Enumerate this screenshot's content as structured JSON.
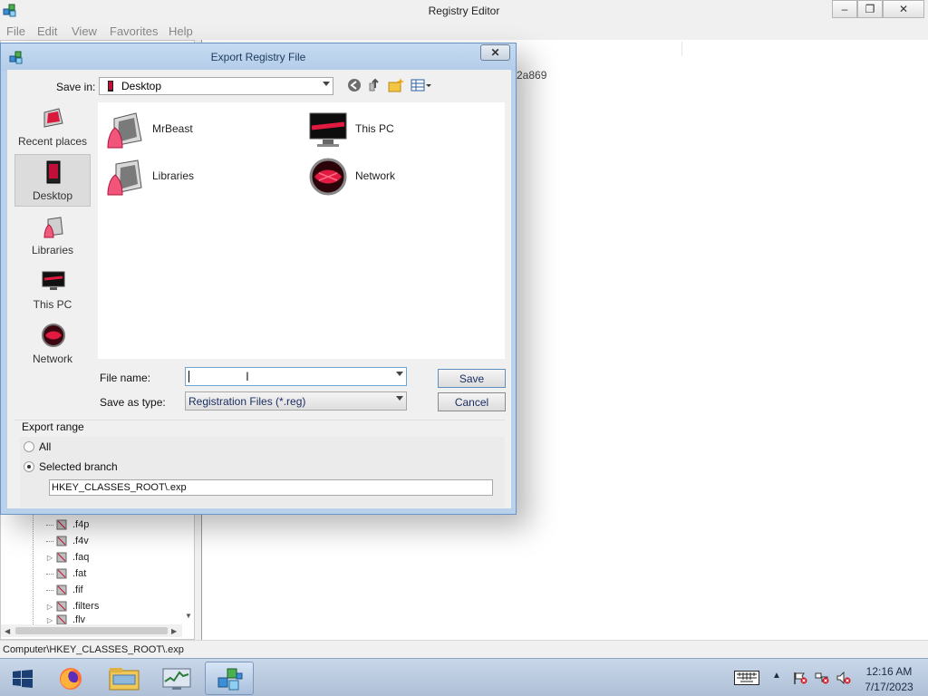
{
  "main_window": {
    "title": "Registry Editor",
    "menu": [
      "File",
      "Edit",
      "View",
      "Favorites",
      "Help"
    ],
    "value_pane_fragment": "2a869",
    "tree_items": [
      {
        "label": ".f4p",
        "expandable": false
      },
      {
        "label": ".f4v",
        "expandable": false
      },
      {
        "label": ".faq",
        "expandable": true
      },
      {
        "label": ".fat",
        "expandable": false
      },
      {
        "label": ".fif",
        "expandable": false
      },
      {
        "label": ".filters",
        "expandable": true
      },
      {
        "label": ".flv",
        "expandable": true
      }
    ],
    "status_path": "Computer\\HKEY_CLASSES_ROOT\\.exp"
  },
  "dialog": {
    "title": "Export Registry File",
    "close_glyph": "✕",
    "save_in_label": "Save in:",
    "save_in_value": "Desktop",
    "places": [
      {
        "label": "Recent places",
        "icon": "recent-places-icon",
        "active": false
      },
      {
        "label": "Desktop",
        "icon": "desktop-icon",
        "active": true
      },
      {
        "label": "Libraries",
        "icon": "libraries-icon",
        "active": false
      },
      {
        "label": "This PC",
        "icon": "this-pc-icon",
        "active": false
      },
      {
        "label": "Network",
        "icon": "network-icon",
        "active": false
      }
    ],
    "files": [
      {
        "name": "MrBeast",
        "icon": "user-folder-icon"
      },
      {
        "name": "This PC",
        "icon": "computer-icon"
      },
      {
        "name": "Libraries",
        "icon": "libraries-icon"
      },
      {
        "name": "Network",
        "icon": "network-icon"
      }
    ],
    "file_name_label": "File name:",
    "file_name_value": "",
    "save_as_type_label": "Save as type:",
    "save_as_type_value": "Registration Files (*.reg)",
    "save_button": "Save",
    "cancel_button": "Cancel",
    "export_range_label": "Export range",
    "range_all_label": "All",
    "range_selected_label": "Selected branch",
    "selected_range": "Selected branch",
    "branch_value": "HKEY_CLASSES_ROOT\\.exp"
  },
  "taskbar": {
    "apps": [
      "start-button",
      "firefox",
      "file-explorer",
      "task-manager",
      "registry-editor"
    ],
    "active_app": "registry-editor",
    "time": "12:16 AM",
    "date": "7/17/2023"
  },
  "colors": {
    "dialog_frame": "#b9d1ea",
    "accent_red": "#d0103a",
    "taskbar": "#b7c7dd"
  }
}
